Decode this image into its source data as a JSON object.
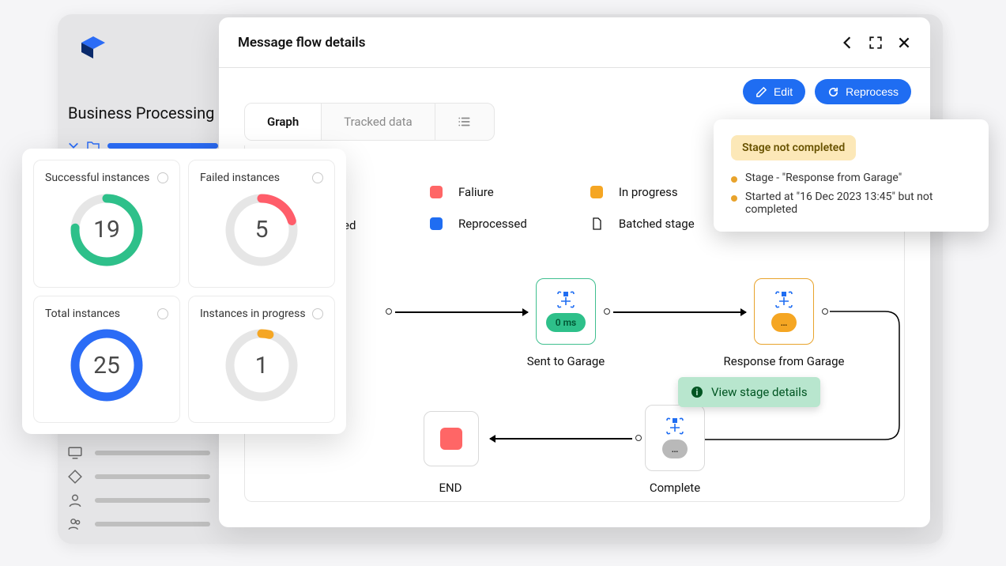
{
  "back": {
    "title": "Business Processing"
  },
  "panel": {
    "title": "Message flow details"
  },
  "actions": {
    "edit_label": "Edit",
    "reprocess_label": "Reprocess"
  },
  "tabs": {
    "graph": "Graph",
    "tracked": "Tracked data"
  },
  "legend": {
    "failure": "Faliure",
    "in_progress": "In progress",
    "reprocessed": "Reprocessed",
    "batched": "Batched stage"
  },
  "clipped_word": "ed",
  "flow": {
    "node1": {
      "label": "Sent to Garage",
      "time": "0 ms"
    },
    "node2": {
      "label": "Response from Garage",
      "pill": "…"
    },
    "node3": {
      "label": "Complete",
      "pill": "…"
    },
    "end_label": "END"
  },
  "tip": {
    "text": "View stage details"
  },
  "popover": {
    "status": "Stage not completed",
    "line1": "Stage - \"Response from Garage\"",
    "line2": "Started at \"16 Dec 2023 13:45\" but not completed"
  },
  "kpi": {
    "successful": {
      "title": "Successful instances",
      "value": "19"
    },
    "failed": {
      "title": "Failed instances",
      "value": "5"
    },
    "total": {
      "title": "Total instances",
      "value": "25"
    },
    "progress": {
      "title": "Instances in progress",
      "value": "1"
    }
  },
  "chart_data": [
    {
      "type": "pie",
      "title": "Successful instances",
      "value": 19,
      "total": 25,
      "fraction": 0.76,
      "color": "#2ec08a"
    },
    {
      "type": "pie",
      "title": "Failed instances",
      "value": 5,
      "total": 25,
      "fraction": 0.2,
      "color": "#ff5d6a"
    },
    {
      "type": "pie",
      "title": "Total instances",
      "value": 25,
      "total": 25,
      "fraction": 1.0,
      "color": "#2b6cf6"
    },
    {
      "type": "pie",
      "title": "Instances in progress",
      "value": 1,
      "total": 25,
      "fraction": 0.04,
      "color": "#f5a623"
    }
  ],
  "colors": {
    "failure": "#ff6666",
    "in_progress": "#f5a623",
    "reprocessed": "#1f6df2",
    "accent_green": "#2ec08a"
  }
}
